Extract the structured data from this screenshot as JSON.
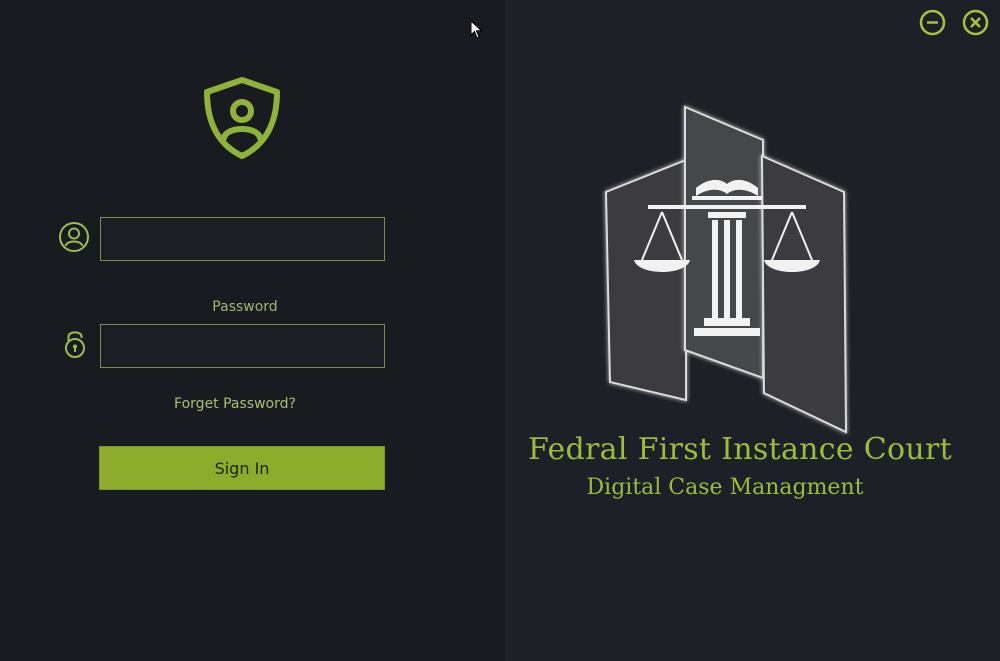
{
  "login": {
    "username_value": "",
    "password_label": "Password",
    "password_value": "",
    "forget_password_label": "Forget Password?",
    "sign_in_label": "Sign In"
  },
  "branding": {
    "title": "Fedral First Instance Court",
    "subtitle": "Digital Case Managment"
  },
  "icons": {
    "logo": "shield-user-icon",
    "username_field": "user-circle-icon",
    "password_field": "padlock-icon",
    "minimize": "minus-circle-icon",
    "close": "x-circle-icon",
    "emblem": "scales-of-justice-icon"
  },
  "colors": {
    "accent": "#8cad2c",
    "accent_text": "#9dbb3d",
    "left_background": "#181b20",
    "right_background": "#1d2026",
    "input_border": "#7c8d4a"
  }
}
